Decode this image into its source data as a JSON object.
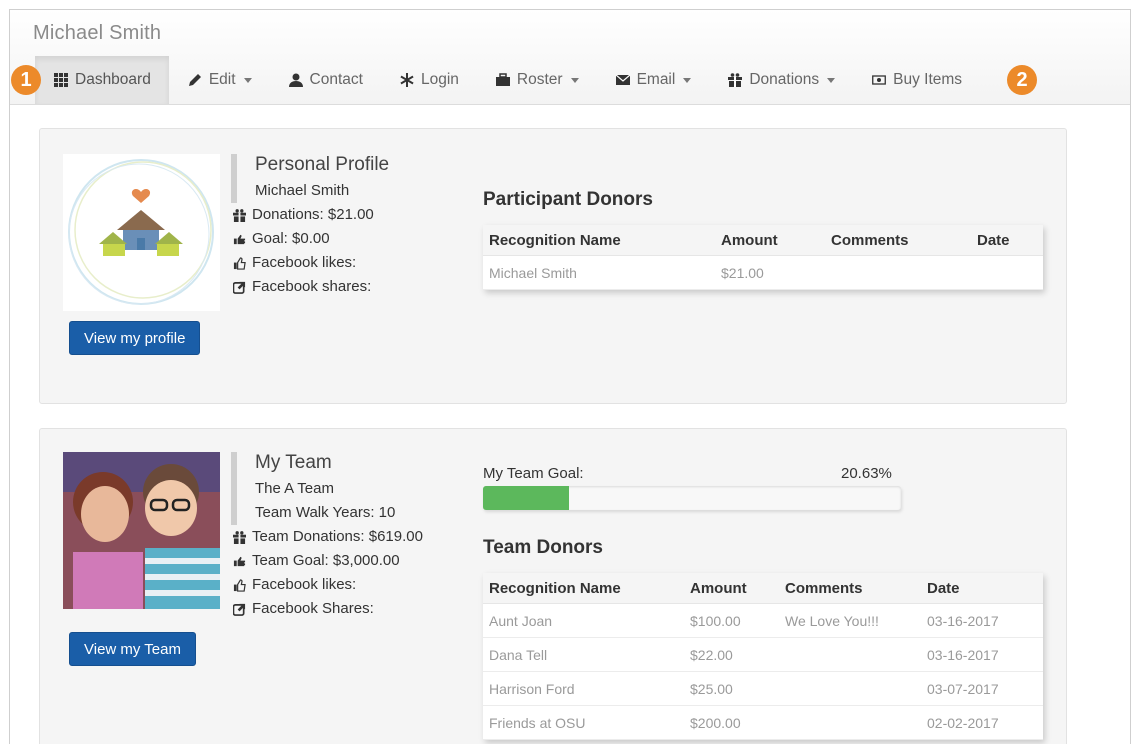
{
  "user_name": "Michael Smith",
  "nav": {
    "items": [
      {
        "label": "Dashboard",
        "icon": "grid-icon",
        "dropdown": false,
        "active": true
      },
      {
        "label": "Edit",
        "icon": "pencil-icon",
        "dropdown": true
      },
      {
        "label": "Contact",
        "icon": "user-icon",
        "dropdown": false
      },
      {
        "label": "Login",
        "icon": "asterisk-icon",
        "dropdown": false
      },
      {
        "label": "Roster",
        "icon": "briefcase-icon",
        "dropdown": true
      },
      {
        "label": "Email",
        "icon": "envelope-icon",
        "dropdown": true
      },
      {
        "label": "Donations",
        "icon": "gift-icon",
        "dropdown": true
      },
      {
        "label": "Buy Items",
        "icon": "money-icon",
        "dropdown": false
      }
    ]
  },
  "callouts": {
    "one": "1",
    "two": "2"
  },
  "profile": {
    "title": "Personal Profile",
    "name": "Michael Smith",
    "donations": "Donations: $21.00",
    "goal": "Goal: $0.00",
    "fb_likes": "Facebook likes:",
    "fb_shares": "Facebook shares:",
    "button": "View my profile"
  },
  "participant_donors": {
    "title": "Participant Donors",
    "headers": [
      "Recognition Name",
      "Amount",
      "Comments",
      "Date"
    ],
    "rows": [
      [
        "Michael Smith",
        "$21.00",
        "",
        ""
      ]
    ]
  },
  "team": {
    "title": "My Team",
    "name": "The A Team",
    "walk_years": "Team Walk Years: 10",
    "donations": "Team Donations: $619.00",
    "goal": "Team Goal: $3,000.00",
    "fb_likes": "Facebook likes:",
    "fb_shares": "Facebook Shares:",
    "button": "View my Team",
    "goal_label": "My Team Goal:",
    "goal_percent_text": "20.63%",
    "goal_fraction": 0.2063
  },
  "team_donors": {
    "title": "Team Donors",
    "headers": [
      "Recognition Name",
      "Amount",
      "Comments",
      "Date"
    ],
    "rows": [
      [
        "Aunt Joan",
        "$100.00",
        "We Love You!!!",
        "03-16-2017"
      ],
      [
        "Dana Tell",
        "$22.00",
        "",
        "03-16-2017"
      ],
      [
        "Harrison Ford",
        "$25.00",
        "",
        "03-07-2017"
      ],
      [
        "Friends at OSU",
        "$200.00",
        "",
        "02-02-2017"
      ]
    ]
  },
  "colors": {
    "accent": "#1a5ea8",
    "progress": "#5cb85c",
    "callout": "#ec8a2a"
  }
}
